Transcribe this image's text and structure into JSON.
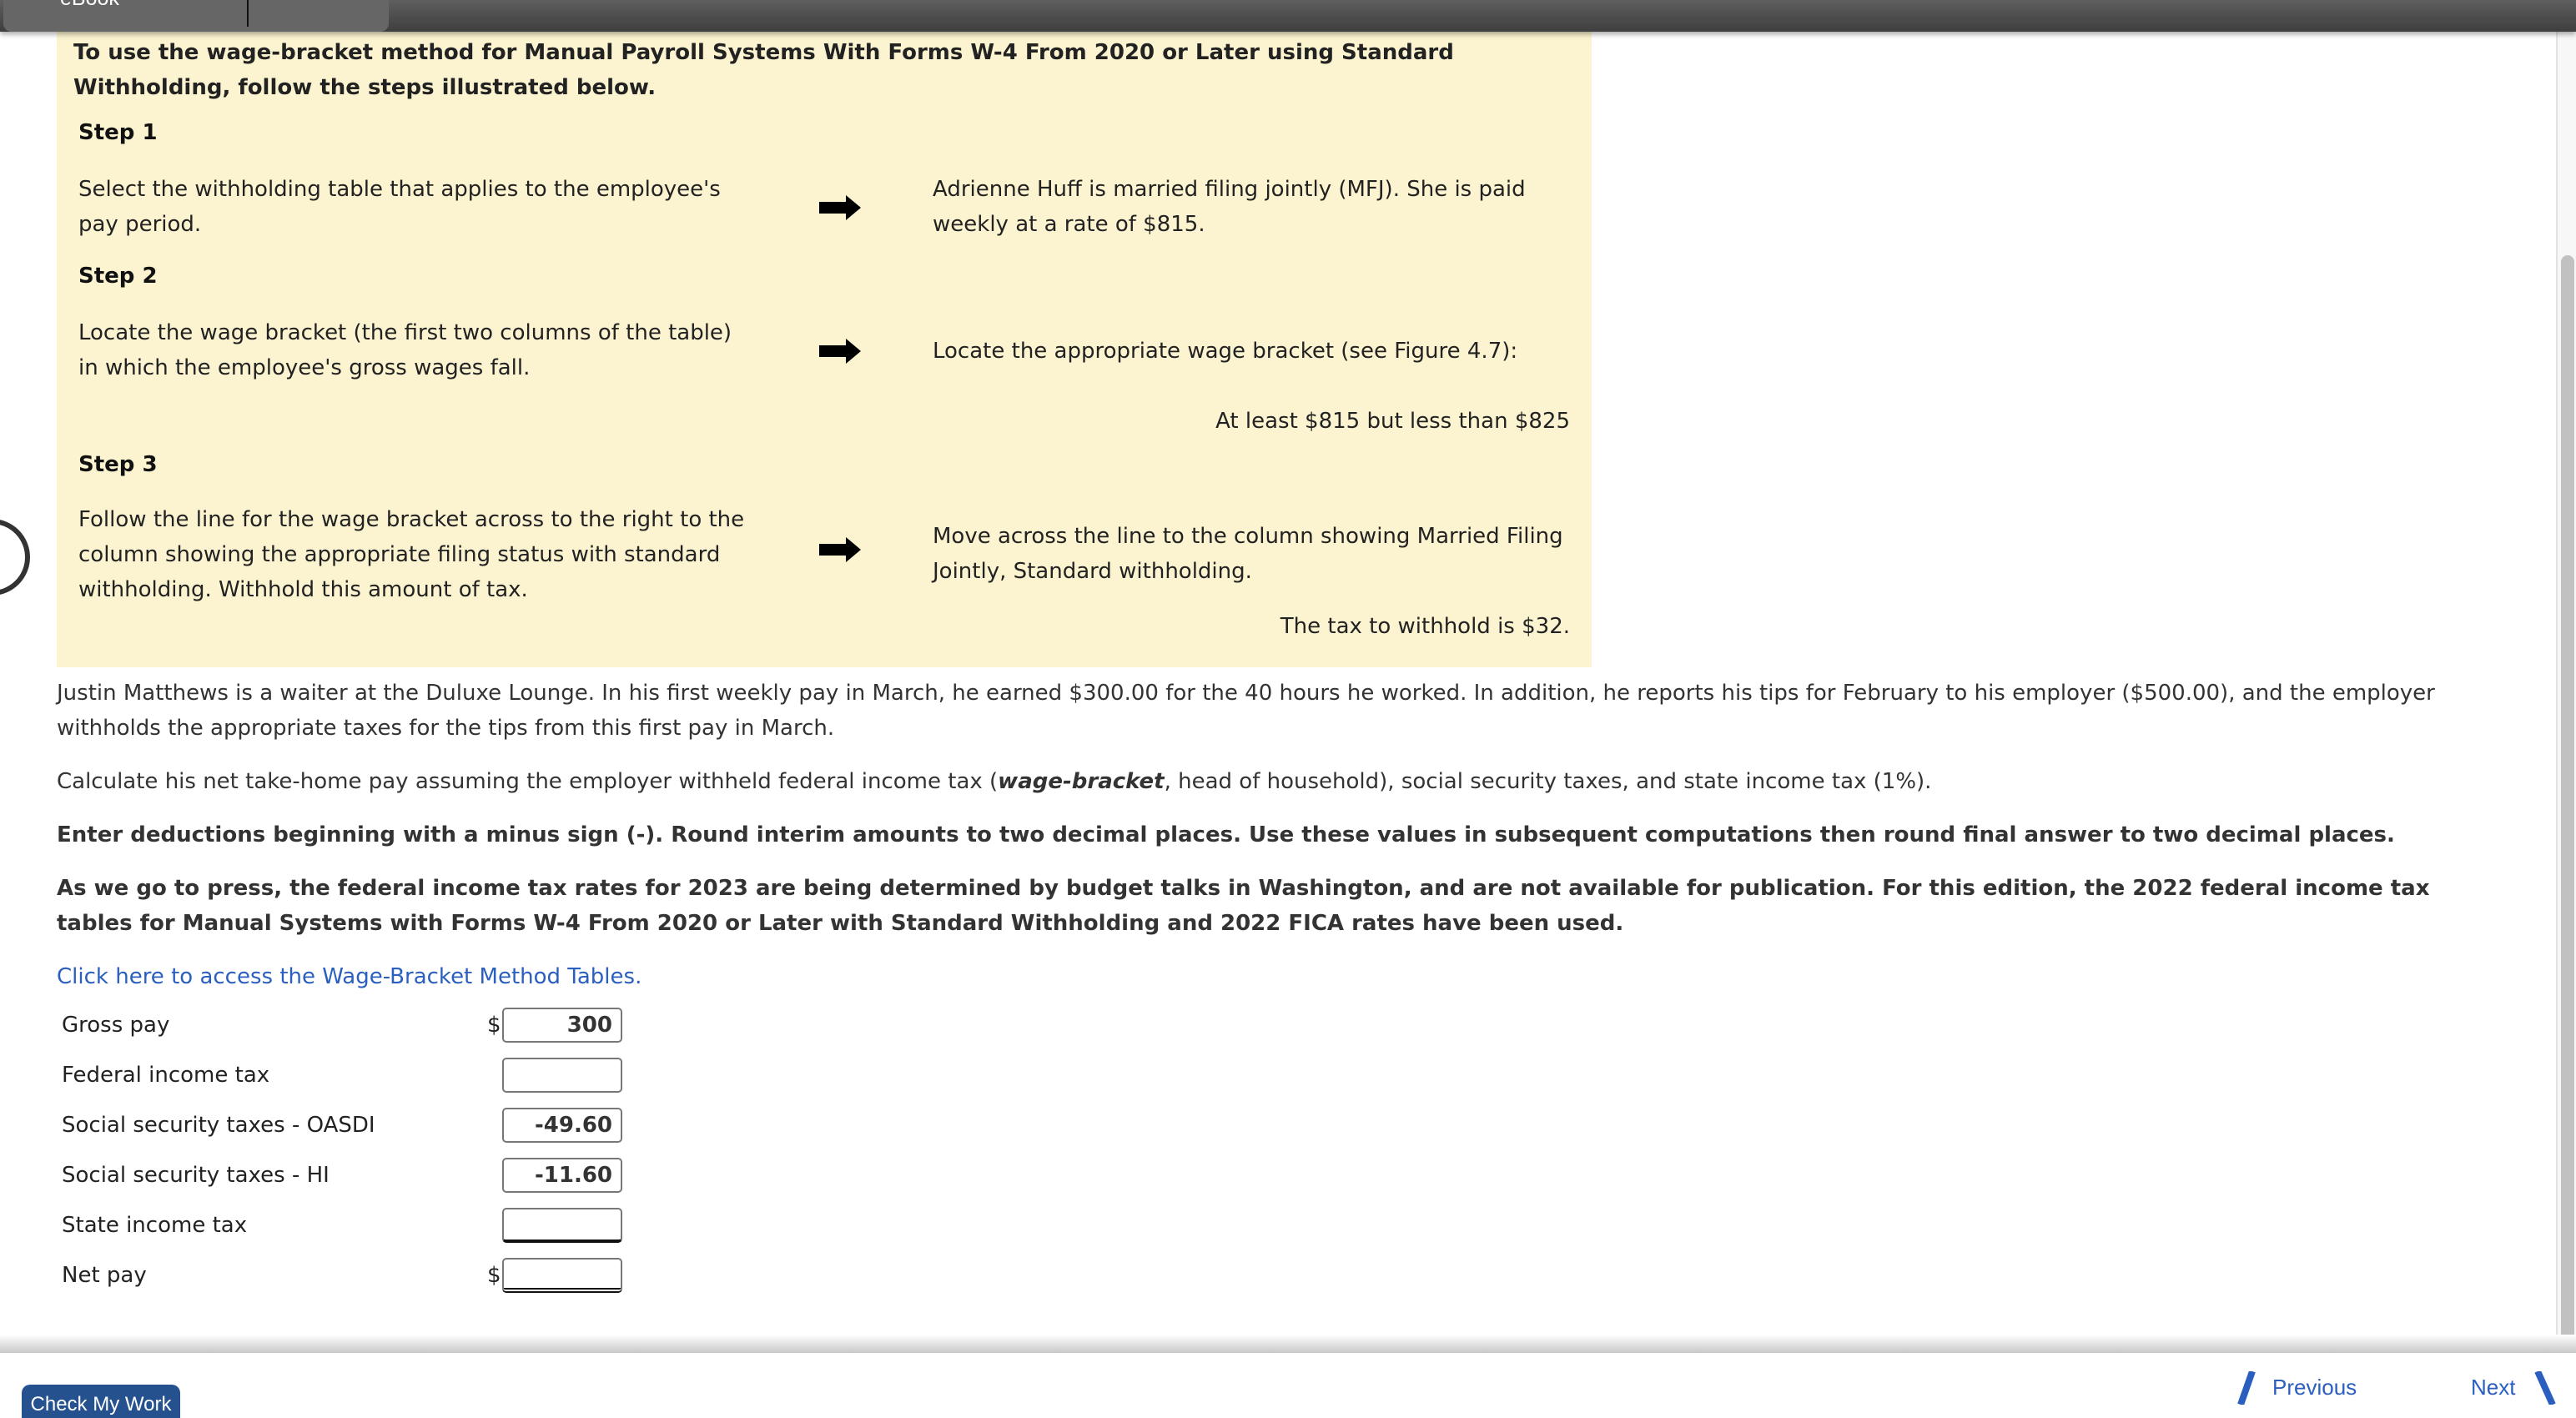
{
  "topbar": {
    "tab_label": "eBook"
  },
  "guide": {
    "intro": "To use the wage-bracket method for Manual Payroll Systems With Forms W-4 From 2020 or Later using Standard Withholding, follow the steps illustrated below.",
    "steps": [
      {
        "heading": "Step 1",
        "instruction": "Select the withholding table that applies to the employee's pay period.",
        "example": "Adrienne Huff is married filing jointly (MFJ). She is paid weekly at a rate of $815.",
        "result": ""
      },
      {
        "heading": "Step 2",
        "instruction": "Locate the wage bracket (the first two columns of the table) in which the employee's gross wages fall.",
        "example": "Locate the appropriate wage bracket (see Figure 4.7):",
        "result": "At least $815 but less than $825"
      },
      {
        "heading": "Step 3",
        "instruction": "Follow the line for the wage bracket across to the right to the column showing the appropriate filing status with standard withholding. Withhold this amount of tax.",
        "example": "Move across the line to the column showing Married Filing Jointly, Standard withholding.",
        "result": "The tax to withhold is $32."
      }
    ]
  },
  "problem": {
    "scenario": "Justin Matthews is a waiter at the Duluxe Lounge. In his first weekly pay in March, he earned $300.00 for the 40 hours he worked. In addition, he reports his tips for February to his employer ($500.00), and the employer withholds the appropriate taxes for the tips from this first pay in March.",
    "calc_prefix": "Calculate his net take-home pay assuming the employer withheld federal income tax (",
    "calc_emph": "wage-bracket",
    "calc_suffix": ", head of household), social security taxes, and state income tax (1%).",
    "instructions": "Enter deductions beginning with a minus sign (-). Round interim amounts to two decimal places. Use these values in subsequent computations then round final answer to two decimal places.",
    "note": "As we go to press, the federal income tax rates for 2023 are being determined by budget talks in Washington, and are not available for publication. For this edition, the 2022 federal income tax tables for Manual Systems with Forms W-4 From 2020 or Later with Standard Withholding and 2022 FICA rates have been used.",
    "link_text": "Click here to access the Wage-Bracket Method Tables."
  },
  "form": {
    "currency_symbol": "$",
    "rows": [
      {
        "label": "Gross pay",
        "value": "300",
        "show_dollar": true
      },
      {
        "label": "Federal income tax",
        "value": "",
        "show_dollar": false
      },
      {
        "label": "Social security taxes - OASDI",
        "value": "-49.60",
        "show_dollar": false
      },
      {
        "label": "Social security taxes - HI",
        "value": "-11.60",
        "show_dollar": false
      },
      {
        "label": "State income tax",
        "value": "",
        "show_dollar": false
      },
      {
        "label": "Net pay",
        "value": "",
        "show_dollar": true
      }
    ]
  },
  "footer": {
    "check_button": "Check My Work",
    "previous": "Previous",
    "next": "Next"
  },
  "colors": {
    "highlight_bg": "#fcf4d0",
    "link": "#2b5fbf",
    "button": "#25528e"
  }
}
